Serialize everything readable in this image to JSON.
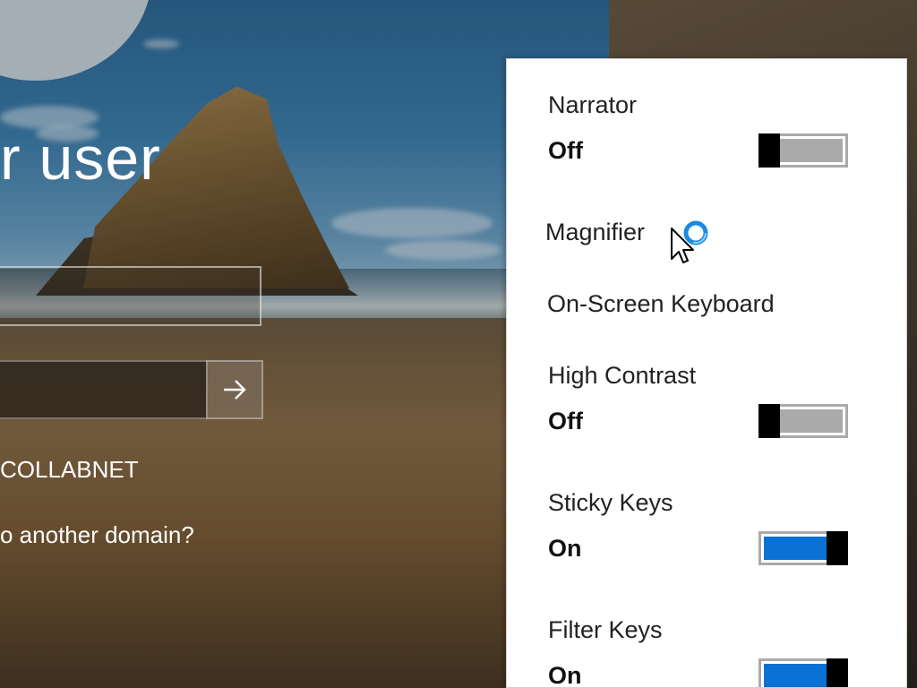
{
  "signin": {
    "title": "r user",
    "username_value": "",
    "password_value": "",
    "domain": "COLLABNET",
    "other_domain_link": "o another domain?"
  },
  "ease_of_access": {
    "narrator": {
      "label": "Narrator",
      "state": "Off",
      "on": false
    },
    "magnifier": {
      "label": "Magnifier"
    },
    "onscreen_keyboard": {
      "label": "On-Screen Keyboard"
    },
    "high_contrast": {
      "label": "High Contrast",
      "state": "Off",
      "on": false
    },
    "sticky_keys": {
      "label": "Sticky Keys",
      "state": "On",
      "on": true
    },
    "filter_keys": {
      "label": "Filter Keys",
      "state": "On",
      "on": true
    }
  },
  "colors": {
    "toggle_on": "#0a72d4",
    "toggle_off": "#aaaaaa",
    "flyout_bg": "#ffffff"
  },
  "icons": {
    "submit": "arrow-right-icon",
    "cursor": "busy-pointer-icon"
  }
}
